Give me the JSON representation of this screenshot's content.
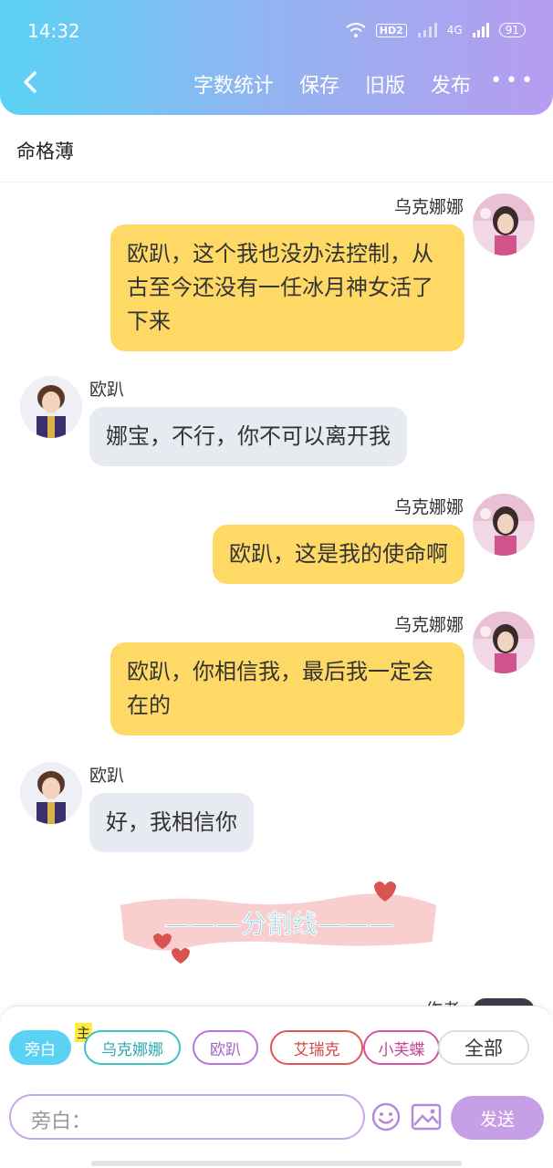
{
  "status": {
    "time": "14:32",
    "network": "4G",
    "hd": "HD2",
    "battery": "91"
  },
  "toolbar": {
    "items": [
      "字数统计",
      "保存",
      "旧版",
      "发布"
    ],
    "more": "•••"
  },
  "subheader": {
    "title": "命格薄"
  },
  "messages": [
    {
      "side": "right",
      "sender": "乌克娜娜",
      "text": "欧趴，这个我也没办法控制，从古至今还没有一任冰月神女活了下来"
    },
    {
      "side": "left",
      "sender": "欧趴",
      "text": "娜宝，不行，你不可以离开我"
    },
    {
      "side": "right",
      "sender": "乌克娜娜",
      "text": "欧趴，这是我的使命啊"
    },
    {
      "side": "right",
      "sender": "乌克娜娜",
      "text": "欧趴，你相信我，最后我一定会在的"
    },
    {
      "side": "left",
      "sender": "欧趴",
      "text": "好，我相信你"
    }
  ],
  "divider": {
    "text": "———分割线———"
  },
  "partial": {
    "sender": "作者"
  },
  "bottom": {
    "chips": [
      "旁白",
      "乌克娜娜",
      "欧趴",
      "艾瑞克",
      "小芙蝶",
      "全部"
    ],
    "main_badge": "主",
    "input_placeholder": "旁白：",
    "send": "发送"
  },
  "colors": {
    "header_start": "#5ad2f4",
    "header_end": "#b79cf0",
    "bubble_right": "#ffd966",
    "bubble_left": "#e7eaf1",
    "send": "#c79fe6"
  }
}
